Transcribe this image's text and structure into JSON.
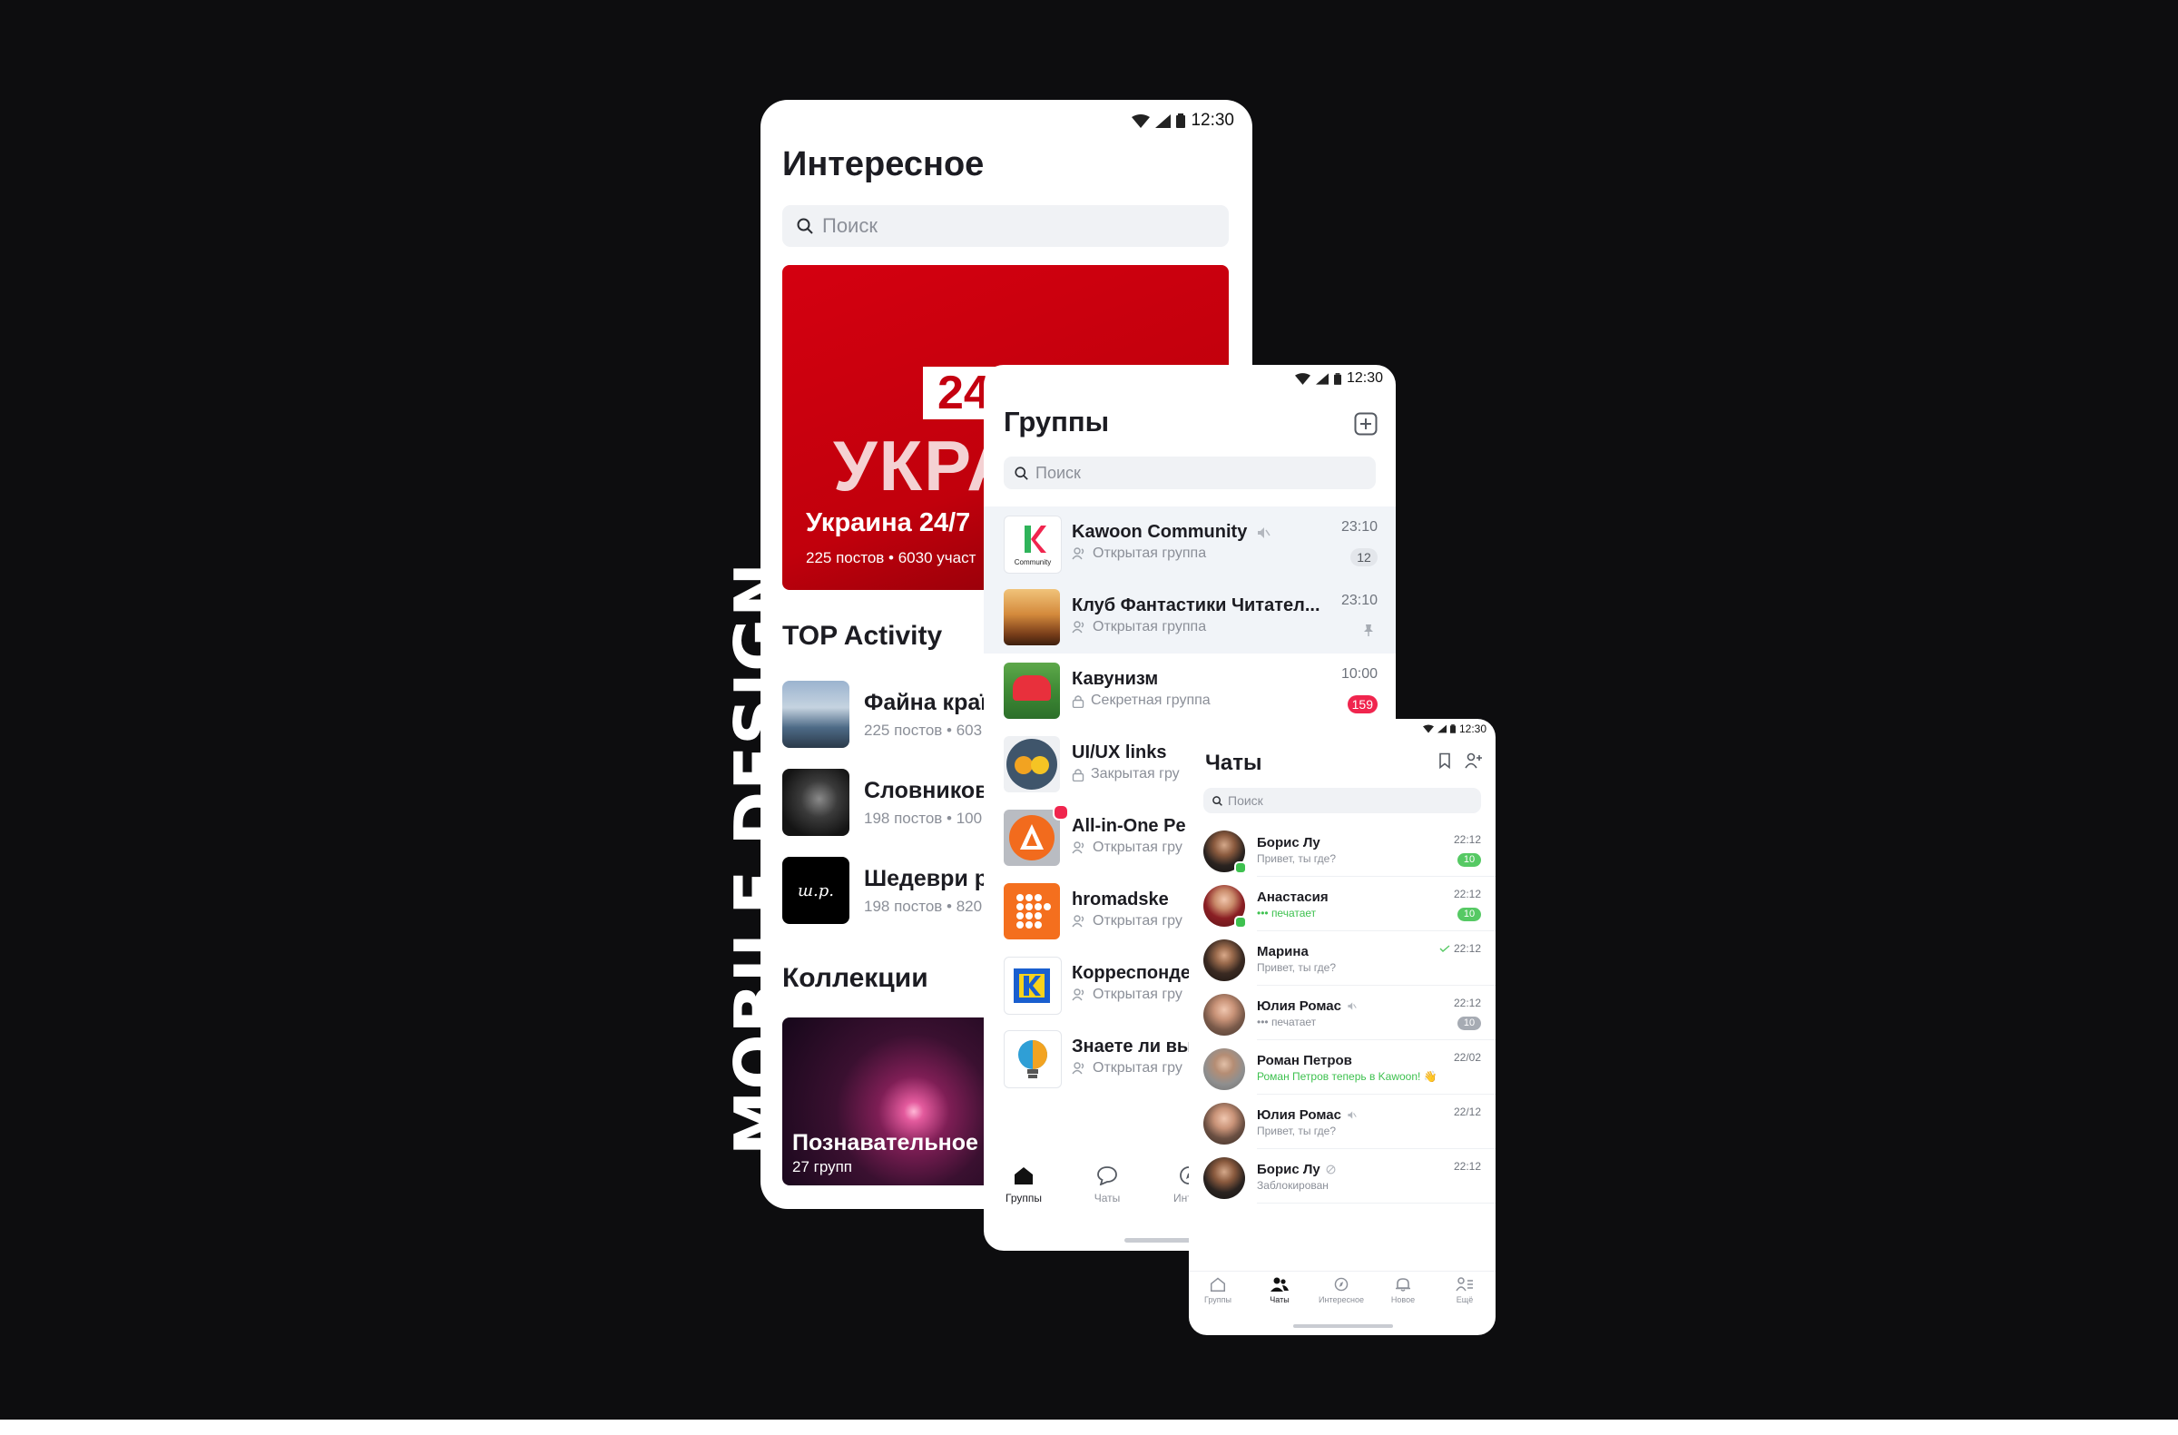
{
  "side_title": "MOBILE DESIGN",
  "phone_explore": {
    "status_time": "12:30",
    "title": "Интересное",
    "search_placeholder": "Поиск",
    "hero": {
      "badge": "24",
      "word": "УКРА",
      "title": "Украина 24/7",
      "meta": "225 постов • 6030 участ"
    },
    "top_activity_title": "TOP Activity",
    "top_activity": [
      {
        "name": "Файна краї",
        "meta": "225 постов • 603"
      },
      {
        "name": "Словников",
        "meta": "198 постов • 100"
      },
      {
        "name": "Шедеври р",
        "meta": "198 постов • 820",
        "logo": "ш.р."
      }
    ],
    "collections_title": "Коллекции",
    "collection": {
      "title": "Познавательное",
      "meta": "27 групп"
    }
  },
  "phone_groups": {
    "status_time": "12:30",
    "title": "Группы",
    "search_placeholder": "Поиск",
    "groups": [
      {
        "name": "Kawoon Community",
        "type": "Открытая группа",
        "time": "23:10",
        "count": "12",
        "avatar_caption": "Community"
      },
      {
        "name": "Клуб Фантастики Читател...",
        "type": "Открытая группа",
        "time": "23:10"
      },
      {
        "name": "Кавунизм",
        "type": "Секретная группа",
        "time": "10:00",
        "count": "159"
      },
      {
        "name": "UI/UX links",
        "type": "Закрытая гру"
      },
      {
        "name": "All-in-One Pe",
        "type": "Открытая гру"
      },
      {
        "name": "hromadske",
        "type": "Открытая гру"
      },
      {
        "name": "Корреспонде",
        "type": "Открытая гру"
      },
      {
        "name": "Знаете ли вы",
        "type": "Открытая гру"
      }
    ],
    "tabs": [
      {
        "label": "Группы"
      },
      {
        "label": "Чаты"
      },
      {
        "label": "Интер"
      }
    ]
  },
  "phone_chats": {
    "status_time": "12:30",
    "title": "Чаты",
    "search_placeholder": "Поиск",
    "chats": [
      {
        "name": "Борис Лу",
        "message": "Привет, ты где?",
        "time": "22:12",
        "count": "10"
      },
      {
        "name": "Анастасия",
        "message": "••• печатает",
        "time": "22:12",
        "count": "10"
      },
      {
        "name": "Марина",
        "message": "Привет, ты где?",
        "time": "22:12"
      },
      {
        "name": "Юлия Ромас",
        "message": "••• печатает",
        "time": "22:12",
        "count": "10"
      },
      {
        "name": "Роман Петров",
        "message": "Роман Петров теперь в Kawoon! 👋",
        "time": "22/02"
      },
      {
        "name": "Юлия Ромас",
        "message": "Привет, ты где?",
        "time": "22/12"
      },
      {
        "name": "Борис Лу",
        "message": "Заблокирован",
        "time": "22:12"
      }
    ],
    "tabs": [
      {
        "label": "Группы"
      },
      {
        "label": "Чаты"
      },
      {
        "label": "Интересное"
      },
      {
        "label": "Новое"
      },
      {
        "label": "Ещё"
      }
    ]
  },
  "colors": {
    "background": "#0d0d0f",
    "accent_red": "#f0254e",
    "online_green": "#3ec14f",
    "hero_red": "#d40010"
  }
}
